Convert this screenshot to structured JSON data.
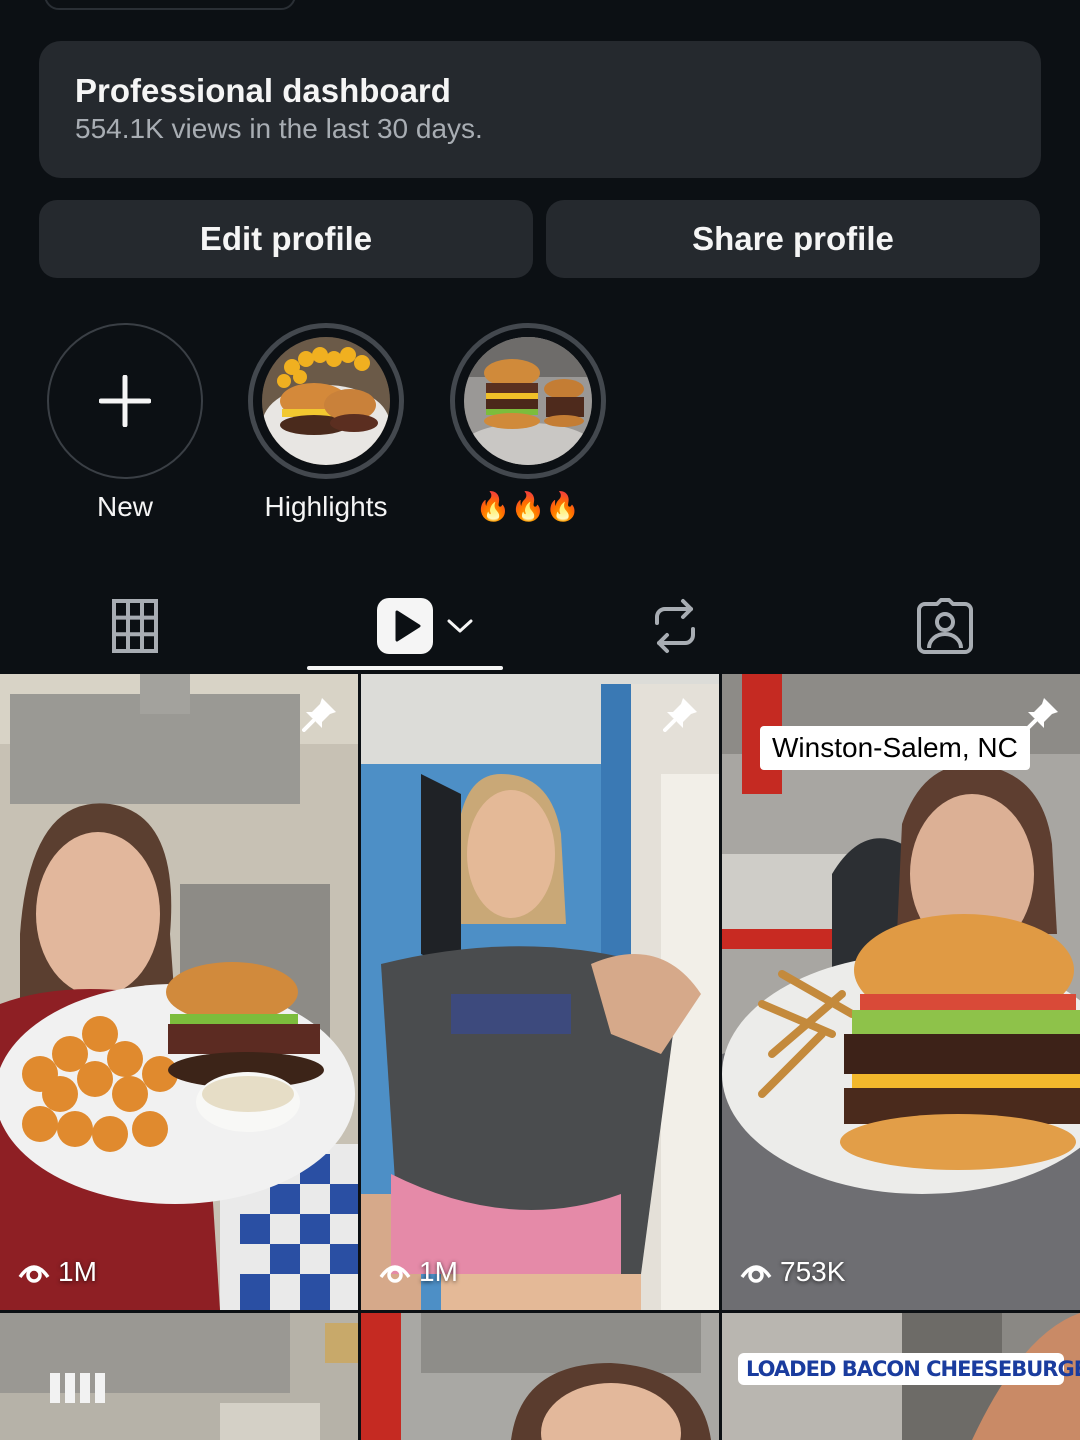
{
  "dashboard": {
    "title": "Professional dashboard",
    "subtitle": "554.1K views in the last 30 days."
  },
  "buttons": {
    "edit": "Edit profile",
    "share": "Share profile"
  },
  "highlights": [
    {
      "label": "New",
      "icon": "plus-icon"
    },
    {
      "label": "Highlights",
      "icon": "burger-fries-photo"
    },
    {
      "label": "🔥🔥🔥",
      "icon": "burgers-photo"
    }
  ],
  "tabs": [
    {
      "icon": "grid-icon",
      "active": false
    },
    {
      "icon": "reels-icon",
      "active": true
    },
    {
      "icon": "repost-icon",
      "active": false
    },
    {
      "icon": "tagged-icon",
      "active": false
    }
  ],
  "posts": [
    {
      "views": "1M",
      "pinned": true
    },
    {
      "views": "1M",
      "pinned": true
    },
    {
      "views": "753K",
      "pinned": true,
      "overlay": "Winston-Salem, NC"
    },
    {
      "views": ""
    },
    {
      "views": ""
    },
    {
      "views": "",
      "overlay": "LOADED BACON CHEESEBURGER FRIES"
    }
  ],
  "colors": {
    "background": "#0c1014",
    "card": "#25292e",
    "text": "#f5f5f5",
    "muted": "#a8adb3"
  }
}
